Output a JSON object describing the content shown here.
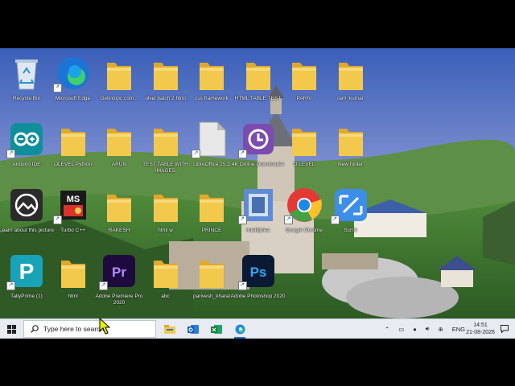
{
  "desktop": {
    "icons": [
      {
        "label": "Recycle Bin",
        "kind": "recycle-bin",
        "shortcut": false
      },
      {
        "label": "Microsoft Edge",
        "kind": "edge",
        "shortcut": true
      },
      {
        "label": "Getintopc.com...",
        "kind": "folder",
        "shortcut": false
      },
      {
        "label": "olvel batch 2 html",
        "kind": "folder",
        "shortcut": false
      },
      {
        "label": "css framework",
        "kind": "folder",
        "shortcut": false
      },
      {
        "label": "HTML TABLE TEST",
        "kind": "folder",
        "shortcut": false
      },
      {
        "label": "PARIV",
        "kind": "folder",
        "shortcut": false
      },
      {
        "label": "ram_kumar",
        "kind": "folder",
        "shortcut": false
      },
      {
        "label": "Arduino IDE",
        "kind": "arduino",
        "shortcut": true
      },
      {
        "label": "OLEVEL Python",
        "kind": "folder",
        "shortcut": false
      },
      {
        "label": "ARUN",
        "kind": "folder",
        "shortcut": false
      },
      {
        "label": "TEST TABLE WITH IMAGES",
        "kind": "folder",
        "shortcut": false
      },
      {
        "label": "LibreOffice 25.2",
        "kind": "libreoffice",
        "shortcut": true
      },
      {
        "label": "4K Online Downloader",
        "kind": "downloader",
        "shortcut": true
      },
      {
        "label": "O LEVEL",
        "kind": "folder",
        "shortcut": false
      },
      {
        "label": "New folder",
        "kind": "folder",
        "shortcut": false
      },
      {
        "label": "Learn about this picture",
        "kind": "learn",
        "shortcut": false
      },
      {
        "label": "Turbo C++",
        "kind": "turbo",
        "shortcut": true
      },
      {
        "label": "RAKESH",
        "kind": "folder",
        "shortcut": false
      },
      {
        "label": "html w",
        "kind": "folder",
        "shortcut": false
      },
      {
        "label": "PRINCE",
        "kind": "folder",
        "shortcut": false
      },
      {
        "label": "Intellijidea",
        "kind": "intellij",
        "shortcut": true
      },
      {
        "label": "Google Chrome",
        "kind": "chrome",
        "shortcut": true
      },
      {
        "label": "Scrnli",
        "kind": "scrnli",
        "shortcut": true
      },
      {
        "label": "TallyPrime (1)",
        "kind": "tally",
        "shortcut": true
      },
      {
        "label": "html",
        "kind": "folder",
        "shortcut": false
      },
      {
        "label": "Adobe Premiere Pro 2020",
        "kind": "premiere",
        "shortcut": true
      },
      {
        "label": "abc",
        "kind": "folder",
        "shortcut": false
      },
      {
        "label": "parivesh_kharal",
        "kind": "folder",
        "shortcut": false
      },
      {
        "label": "Adobe Photoshop 2020",
        "kind": "photoshop",
        "shortcut": true
      }
    ]
  },
  "taskbar": {
    "search_placeholder": "Type here to search",
    "pinned": [
      {
        "name": "file-explorer-icon"
      },
      {
        "name": "outlook-icon"
      },
      {
        "name": "excel-icon"
      },
      {
        "name": "edge-taskbar-icon"
      }
    ],
    "tray": {
      "language": "ENG",
      "time": "14:51",
      "date": "21-08-2026"
    }
  },
  "colors": {
    "folder": "#f2c94c",
    "taskbar": "#e8ecf2",
    "accent": "#2a6fd1"
  }
}
